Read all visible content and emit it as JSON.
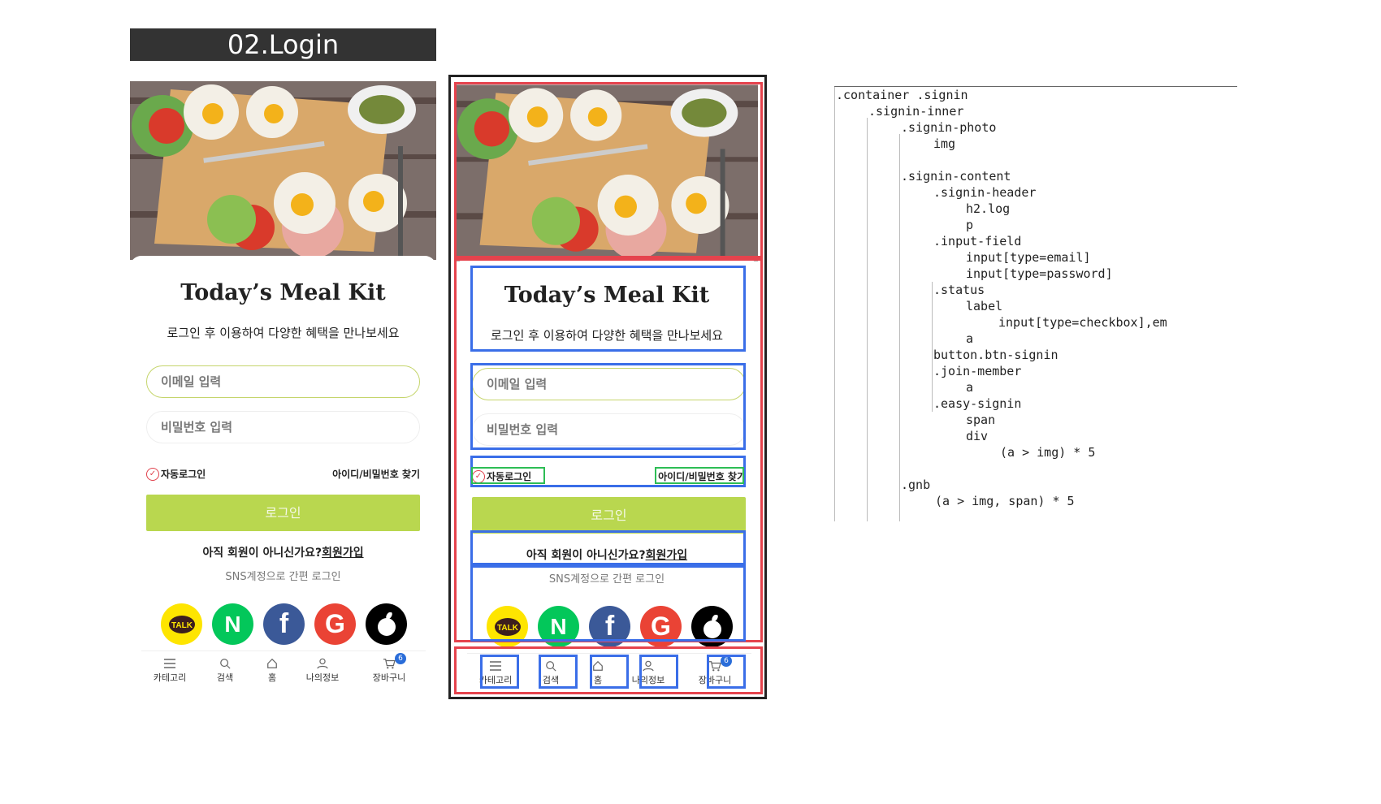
{
  "section_title": "02.Login",
  "brand": "Today’s Meal Kit",
  "subtitle": "로그인 후 이용하여 다양한 혜택을 만나보세요",
  "fields": {
    "email_placeholder": "이메일 입력",
    "password_placeholder": "비밀번호 입력"
  },
  "status": {
    "auto_login": "자동로그인",
    "find_account": "아이디/비밀번호 찾기"
  },
  "signin_button": "로그인",
  "join": {
    "question": "아직 회원이 아니신가요?",
    "link": "회원가입"
  },
  "sns_label": "SNS계정으로 간편 로그인",
  "easy_signin": [
    {
      "name": "kakao-talk",
      "label": "TALK",
      "color": "#fee500"
    },
    {
      "name": "naver",
      "label": "N",
      "color": "#03c75a"
    },
    {
      "name": "facebook",
      "label": "f",
      "color": "#3b5998"
    },
    {
      "name": "google",
      "label": "G",
      "color": "#ea4335"
    },
    {
      "name": "apple",
      "label": "",
      "color": "#000000"
    }
  ],
  "gnb": [
    {
      "label": "카테고리",
      "icon": "menu-icon"
    },
    {
      "label": "검색",
      "icon": "search-icon"
    },
    {
      "label": "홈",
      "icon": "home-icon"
    },
    {
      "label": "나의정보",
      "icon": "user-icon"
    },
    {
      "label": "장바구니",
      "icon": "cart-icon",
      "badge": "6"
    }
  ],
  "code_tree": [
    ".container .signin",
    ".signin-inner",
    ".signin-photo",
    "img",
    ".signin-content",
    ".signin-header",
    "h2.log",
    "p",
    ".input-field",
    "input[type=email]",
    "input[type=password]",
    ".status",
    "label",
    "input[type=checkbox],em",
    "a",
    "button.btn-signin",
    ".join-member",
    "a",
    ".easy-signin",
    "span",
    "div",
    "(a > img) * 5",
    ".gnb",
    "(a > img, span) * 5"
  ],
  "colors": {
    "accent_green": "#b9d74f",
    "overlay_blue": "#3a6ee8",
    "overlay_red": "#e5434d",
    "overlay_green": "#2dbd55"
  }
}
